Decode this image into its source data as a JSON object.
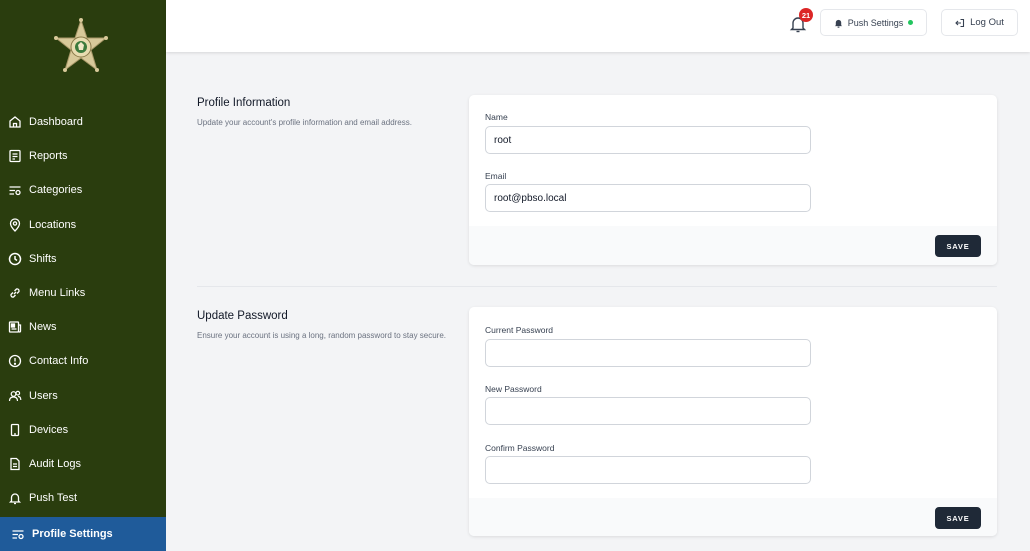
{
  "sidebar": {
    "logo_icon": "sheriff-star-badge",
    "items": [
      {
        "label": "Dashboard",
        "icon": "home-icon"
      },
      {
        "label": "Reports",
        "icon": "report-icon"
      },
      {
        "label": "Categories",
        "icon": "filter-icon"
      },
      {
        "label": "Locations",
        "icon": "map-pin-icon"
      },
      {
        "label": "Shifts",
        "icon": "clock-icon"
      },
      {
        "label": "Menu Links",
        "icon": "link-icon"
      },
      {
        "label": "News",
        "icon": "newspaper-icon"
      },
      {
        "label": "Contact Info",
        "icon": "info-icon"
      },
      {
        "label": "Users",
        "icon": "users-icon"
      },
      {
        "label": "Devices",
        "icon": "phone-icon"
      },
      {
        "label": "Audit Logs",
        "icon": "document-icon"
      },
      {
        "label": "Push Test",
        "icon": "bell-icon"
      },
      {
        "label": "Profile Settings",
        "icon": "settings-icon",
        "active": true
      }
    ]
  },
  "header": {
    "notification_count": "21",
    "push_settings_label": "Push Settings",
    "push_status_color": "#22c55e",
    "logout_label": "Log Out"
  },
  "profile": {
    "title": "Profile Information",
    "description": "Update your account's profile information and email address.",
    "name_label": "Name",
    "name_value": "root",
    "email_label": "Email",
    "email_value": "root@pbso.local",
    "save_label": "SAVE"
  },
  "password": {
    "title": "Update Password",
    "description": "Ensure your account is using a long, random password to stay secure.",
    "current_label": "Current Password",
    "new_label": "New Password",
    "confirm_label": "Confirm Password",
    "save_label": "SAVE"
  },
  "colors": {
    "sidebar_bg": "#2a3d0e",
    "active_item_bg": "#1f5b9a",
    "save_button_bg": "#1f2937",
    "badge_bg": "#dc2626"
  }
}
